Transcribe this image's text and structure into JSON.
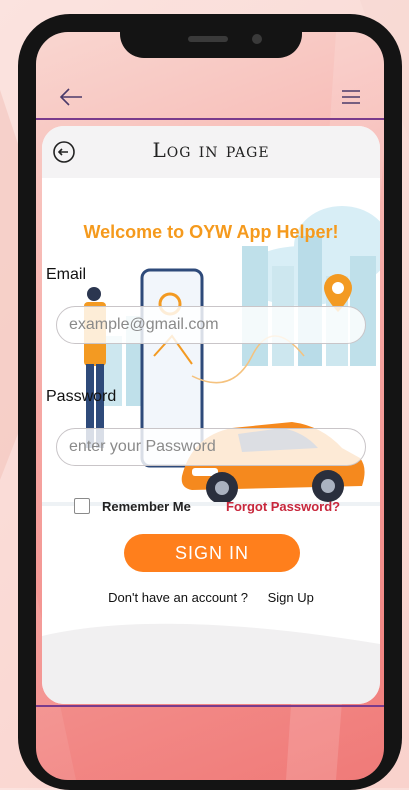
{
  "header": {
    "title": "Log in page",
    "back_icon": "back-arrow-icon",
    "menu_icon": "hamburger-menu-icon",
    "logout_icon": "logout-icon"
  },
  "welcome": "Welcome to OYW App Helper!",
  "form": {
    "email_label": "Email",
    "email_placeholder": "example@gmail.com",
    "email_value": "",
    "password_label": "Password",
    "password_placeholder": "enter your Password",
    "password_value": ""
  },
  "remember_me": {
    "label": "Remember Me",
    "checked": false
  },
  "forgot_password": "Forgot Password?",
  "sign_in_button": "SIGN IN",
  "account_prompt": "Don't have an account ?",
  "sign_up_link": "Sign Up",
  "colors": {
    "accent": "#ff7f1c",
    "welcome": "#f59a1d",
    "link": "#c8273c",
    "divider": "#7a3b8c"
  }
}
